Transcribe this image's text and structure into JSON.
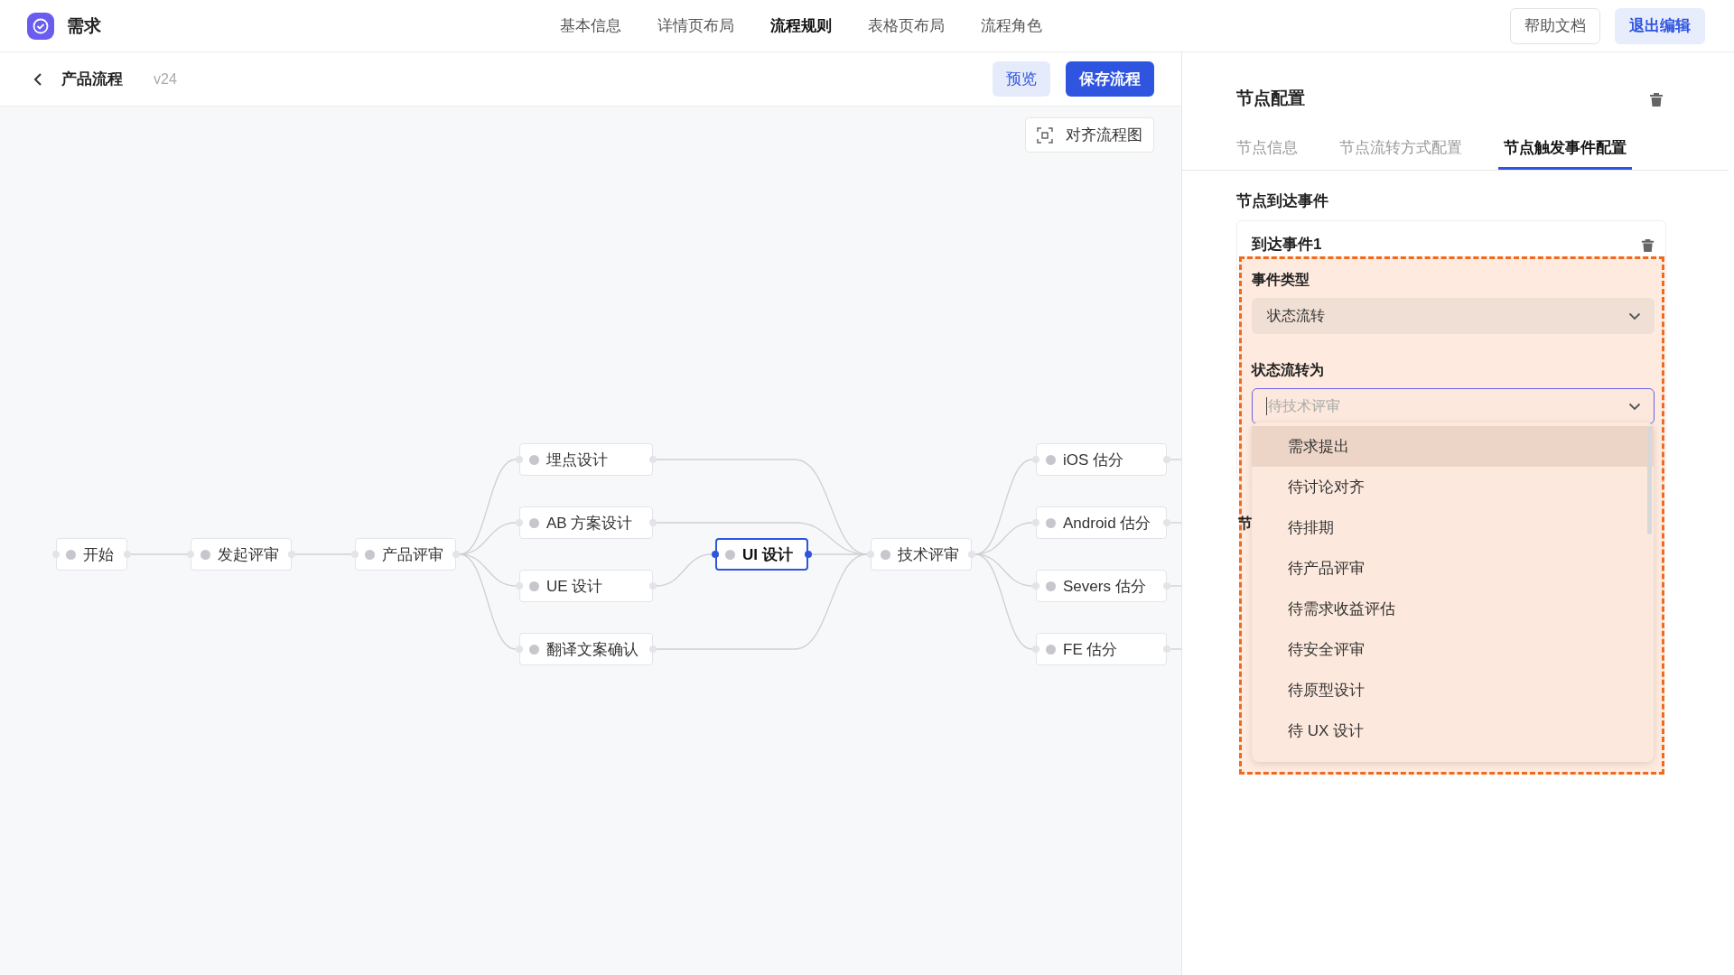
{
  "app": {
    "title": "需求"
  },
  "nav": [
    {
      "label": "基本信息",
      "selected": false
    },
    {
      "label": "详情页布局",
      "selected": false
    },
    {
      "label": "流程规则",
      "selected": true
    },
    {
      "label": "表格页布局",
      "selected": false
    },
    {
      "label": "流程角色",
      "selected": false
    }
  ],
  "header_buttons": [
    {
      "label": "帮助文档",
      "kind": "default"
    },
    {
      "label": "退出编辑",
      "kind": "primary"
    }
  ],
  "flow_bar": {
    "title": "产品流程",
    "version": "v24",
    "buttons": [
      {
        "label": "预览",
        "kind": "secondary"
      },
      {
        "label": "保存流程",
        "kind": "primary"
      }
    ]
  },
  "canvas": {
    "align_button": "对齐流程图",
    "columns": [
      [
        {
          "label": "开始",
          "selected": false
        }
      ],
      [
        {
          "label": "发起评审",
          "selected": false
        }
      ],
      [
        {
          "label": "产品评审",
          "selected": false
        }
      ],
      [
        {
          "label": "埋点设计",
          "selected": false
        },
        {
          "label": "AB 方案设计",
          "selected": false
        },
        {
          "label": "UE 设计",
          "selected": false
        },
        {
          "label": "翻译文案确认",
          "selected": false
        }
      ],
      [
        {
          "label": "UI 设计",
          "selected": true
        }
      ],
      [
        {
          "label": "技术评审",
          "selected": false
        }
      ],
      [
        {
          "label": "iOS 估分",
          "selected": false
        },
        {
          "label": "Android 估分",
          "selected": false
        },
        {
          "label": "Severs 估分",
          "selected": false
        },
        {
          "label": "FE 估分",
          "selected": false
        }
      ]
    ]
  },
  "panel": {
    "title": "节点配置",
    "tabs": [
      {
        "label": "节点信息",
        "selected": false
      },
      {
        "label": "节点流转方式配置",
        "selected": false
      },
      {
        "label": "节点触发事件配置",
        "selected": true
      }
    ],
    "section_title": "节点到达事件",
    "event": {
      "title": "到达事件1",
      "fields": [
        {
          "label": "事件类型",
          "value": "状态流转",
          "focused": false
        },
        {
          "label": "状态流转为",
          "placeholder": "待技术评审",
          "focused": true
        }
      ]
    },
    "dropdown": {
      "options": [
        {
          "label": "需求提出",
          "selected": true
        },
        {
          "label": "待讨论对齐",
          "selected": false
        },
        {
          "label": "待排期",
          "selected": false
        },
        {
          "label": "待产品评审",
          "selected": false
        },
        {
          "label": "待需求收益评估",
          "selected": false
        },
        {
          "label": "待安全评审",
          "selected": false
        },
        {
          "label": "待原型设计",
          "selected": false
        },
        {
          "label": "待 UX 设计",
          "selected": false
        }
      ]
    },
    "next_section_title": "节"
  }
}
